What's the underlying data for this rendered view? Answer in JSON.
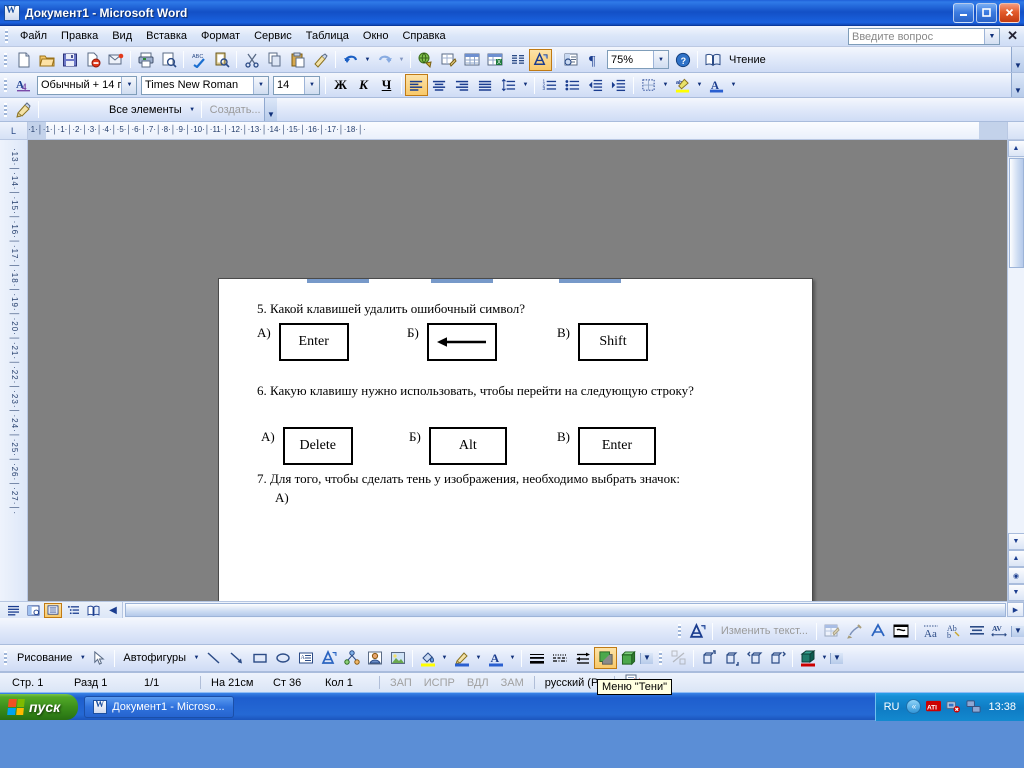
{
  "window": {
    "title": "Документ1 - Microsoft Word",
    "icon": "word-document-icon",
    "minimize": "_",
    "maximize": "□",
    "close": "✕"
  },
  "menubar": {
    "items": [
      {
        "label": "Файл"
      },
      {
        "label": "Правка"
      },
      {
        "label": "Вид"
      },
      {
        "label": "Вставка"
      },
      {
        "label": "Формат"
      },
      {
        "label": "Сервис"
      },
      {
        "label": "Таблица"
      },
      {
        "label": "Окно"
      },
      {
        "label": "Справка"
      }
    ],
    "ask_placeholder": "Введите вопрос",
    "close_label": "✕"
  },
  "toolbar_standard": {
    "zoom_value": "75%",
    "reading_label": "Чтение",
    "buttons": [
      "new-document-icon",
      "open-folder-icon",
      "save-disk-icon",
      "permission-icon",
      "email-icon",
      "print-icon",
      "print-preview-icon",
      "spelling-check-icon",
      "research-icon",
      "cut-scissors-icon",
      "copy-icon",
      "paste-icon",
      "format-painter-icon",
      "undo-icon",
      "redo-icon",
      "hyperlink-icon",
      "tables-borders-icon",
      "insert-table-icon",
      "insert-excel-sheet-icon",
      "columns-icon",
      "drawing-icon",
      "document-map-icon",
      "show-formatting-marks-icon",
      "help-icon",
      "reading-layout-icon"
    ]
  },
  "toolbar_formatting": {
    "style_value": "Обычный + 14 г",
    "font_value": "Times New Roman",
    "size_value": "14",
    "bold_label": "Ж",
    "italic_label": "К",
    "underline_label": "Ч",
    "buttons": [
      "styles-formatting-icon",
      "align-left-icon",
      "align-center-icon",
      "align-right-icon",
      "justify-icon",
      "line-spacing-icon",
      "numbered-list-icon",
      "bulleted-list-icon",
      "decrease-indent-icon",
      "increase-indent-icon",
      "borders-icon",
      "highlight-color-icon",
      "font-color-icon"
    ]
  },
  "toolbar_elements": {
    "icon": "autotext-icon",
    "all_entries_label": "Все элементы",
    "create_label": "Создать..."
  },
  "ruler": {
    "horizontal_ticks": "·1·│·1·│·1·│·2·│·3·│·4·│·5·│·6·│·7·│·8·│·9·│·10·│·11·│·12·│·13·│·14·│·15·│·16·│·17·│·18·│·",
    "vertical_ticks": "·13·│·14·│·15·│·16·│·17·│·18·│·19·│·20·│·21·│·22·│·23·│·24·│·25·│·26·│·27·│·",
    "corner_icon": "tab-stop-icon"
  },
  "document": {
    "questions": [
      {
        "number": "5.",
        "text": "5. Какой клавишей удалить ошибочный символ?",
        "options": [
          {
            "letter": "А)",
            "value": "Enter",
            "type": "text"
          },
          {
            "letter": "Б)",
            "value": "",
            "type": "left-arrow"
          },
          {
            "letter": "В)",
            "value": "Shift",
            "type": "text"
          }
        ]
      },
      {
        "number": "6.",
        "text": "6. Какую клавишу нужно использовать, чтобы перейти на следующую строку?",
        "options": [
          {
            "letter": "А)",
            "value": "Delete",
            "type": "text"
          },
          {
            "letter": "Б)",
            "value": "Alt",
            "type": "text"
          },
          {
            "letter": "В)",
            "value": "Enter",
            "type": "text"
          }
        ]
      },
      {
        "number": "7.",
        "text": "7. Для того, чтобы сделать тень у изображения, необходимо выбрать значок:",
        "options": [
          {
            "letter": "А)",
            "value": "",
            "type": "empty"
          }
        ]
      }
    ]
  },
  "view_buttons": [
    {
      "name": "normal-view",
      "glyph": "≡"
    },
    {
      "name": "web-layout-view",
      "glyph": "◪"
    },
    {
      "name": "print-layout-view",
      "glyph": "▤",
      "active": true
    },
    {
      "name": "outline-view",
      "glyph": "⋮≡"
    },
    {
      "name": "reading-layout-view",
      "glyph": "▥"
    }
  ],
  "toolbar_wordart": {
    "icon": "wordart-icon",
    "edit_text_label": "Изменить текст...",
    "buttons": [
      "wordart-gallery-icon",
      "format-wordart-icon",
      "wordart-shape-icon",
      "text-wrapping-icon",
      "same-letter-heights-icon",
      "vertical-text-icon",
      "wordart-alignment-icon",
      "character-spacing-icon"
    ]
  },
  "toolbar_drawing": {
    "draw_label": "Рисование",
    "autoshapes_label": "Автофигуры",
    "buttons": [
      "select-objects-icon",
      "line-icon",
      "arrow-icon",
      "rectangle-icon",
      "oval-icon",
      "text-box-icon",
      "insert-wordart-icon",
      "insert-diagram-icon",
      "insert-clipart-icon",
      "insert-picture-icon",
      "fill-color-icon",
      "line-color-icon",
      "font-color-icon",
      "line-style-icon",
      "dash-style-icon",
      "arrow-style-icon",
      "shadow-style-icon",
      "3d-style-icon"
    ]
  },
  "toolbar_3d": {
    "buttons": [
      "3d-on-off-icon",
      "tilt-down-icon",
      "tilt-up-icon",
      "tilt-left-icon",
      "tilt-right-icon",
      "depth-icon",
      "direction-icon",
      "lighting-icon",
      "surface-icon",
      "3d-color-icon"
    ]
  },
  "tooltip": {
    "text": "Меню \"Тени\""
  },
  "statusbar": {
    "page_label": "Стр. 1",
    "section_label": "Разд 1",
    "pages_label": "1/1",
    "position_label": "На 21см",
    "line_label": "Ст 36",
    "column_label": "Кол 1",
    "rec_label": "ЗАП",
    "trk_label": "ИСПР",
    "ext_label": "ВДЛ",
    "ovr_label": "ЗАМ",
    "language_label": "русский (Ро",
    "spell_icon": "spelling-status-icon"
  },
  "taskbar": {
    "start_label": "пуск",
    "items": [
      {
        "label": "Документ1 - Microso...",
        "icon": "word-document-icon"
      }
    ],
    "tray": {
      "language": "RU",
      "chevron": "«",
      "icons": [
        "ati-icon",
        "network-warning-icon",
        "network-icon"
      ],
      "clock": "13:38"
    }
  },
  "colors": {
    "title_blue": "#1350c6",
    "taskbar_blue": "#215dc6",
    "start_green": "#3c8f1c",
    "toolbar_face": "#e2eafa",
    "workspace_gray": "#808080",
    "highlight_orange": "#f8c96a"
  }
}
